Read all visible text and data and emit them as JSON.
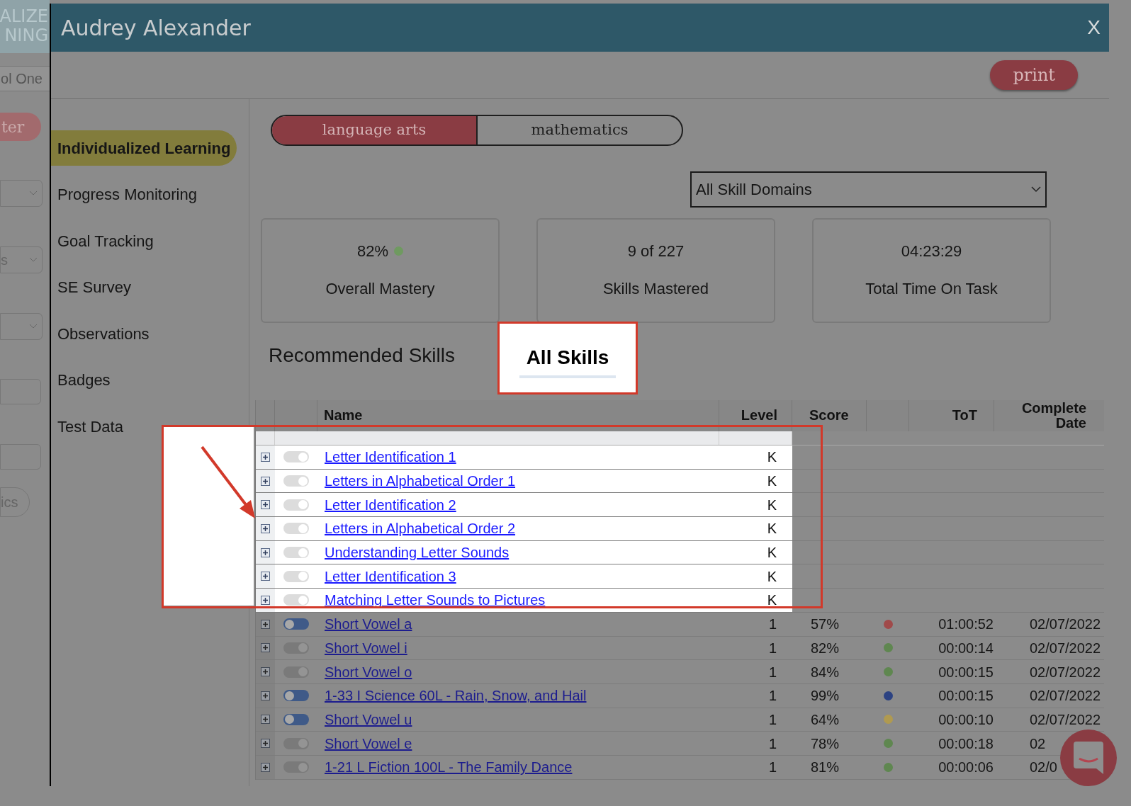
{
  "background": {
    "logo_lines": [
      "ALIZE",
      "NING"
    ],
    "school_field": "ol One",
    "filter_button": "ter",
    "select_value": "s",
    "bottom_button": "ics"
  },
  "window": {
    "title": "Audrey Alexander",
    "close": "X"
  },
  "toolbar": {
    "print_button": "print"
  },
  "sidebar": {
    "items": [
      {
        "label": "Individualized Learning",
        "selected": true
      },
      {
        "label": "Progress Monitoring",
        "selected": false
      },
      {
        "label": "Goal Tracking",
        "selected": false
      },
      {
        "label": "SE Survey",
        "selected": false
      },
      {
        "label": "Observations",
        "selected": false
      },
      {
        "label": "Badges",
        "selected": false
      },
      {
        "label": "Test Data",
        "selected": false
      }
    ]
  },
  "subjects": [
    {
      "label": "language arts",
      "selected": true
    },
    {
      "label": "mathematics",
      "selected": false
    }
  ],
  "domain_select": {
    "value": "All Skill Domains"
  },
  "stats": [
    {
      "value": "82%",
      "label": "Overall Mastery",
      "color": "#6f9a60"
    },
    {
      "value": "9 of 227",
      "label": "Skills Mastered"
    },
    {
      "value": "04:23:29",
      "label": "Total Time On Task"
    }
  ],
  "skill_tabs": [
    {
      "label": "Recommended Skills",
      "selected": false,
      "highlighted": false
    },
    {
      "label": "All Skills",
      "selected": true,
      "highlighted": true
    }
  ],
  "table": {
    "columns": [
      "Name",
      "Level",
      "Score",
      "ToT",
      "Complete Date"
    ],
    "rows": [
      {
        "name": "Letter Identification 1",
        "level": "K",
        "on": true,
        "highlighted": true
      },
      {
        "name": "Letters in Alphabetical Order 1",
        "level": "K",
        "on": true,
        "highlighted": true
      },
      {
        "name": "Letter Identification 2",
        "level": "K",
        "on": true,
        "highlighted": true
      },
      {
        "name": "Letters in Alphabetical Order 2",
        "level": "K",
        "on": true,
        "highlighted": true
      },
      {
        "name": "Understanding Letter Sounds",
        "level": "K",
        "on": true,
        "highlighted": true
      },
      {
        "name": "Letter Identification 3",
        "level": "K",
        "on": true,
        "highlighted": true
      },
      {
        "name": "Matching Letter Sounds to Pictures",
        "level": "K",
        "on": true,
        "highlighted": true
      },
      {
        "name": "Short Vowel a",
        "level": "1",
        "score": "57%",
        "color": "#a04a4a",
        "tot": "01:00:52",
        "date": "02/07/2022",
        "on": false,
        "highlighted": false
      },
      {
        "name": "Short Vowel i",
        "level": "1",
        "score": "82%",
        "color": "#5f8750",
        "tot": "00:00:14",
        "date": "02/07/2022",
        "on": true,
        "highlighted": false
      },
      {
        "name": "Short Vowel o",
        "level": "1",
        "score": "84%",
        "color": "#5f8750",
        "tot": "00:00:15",
        "date": "02/07/2022",
        "on": true,
        "highlighted": false
      },
      {
        "name": "1-33 I Science 60L - Rain, Snow, and Hail",
        "level": "1",
        "score": "99%",
        "color": "#2c4282",
        "tot": "00:00:15",
        "date": "02/07/2022",
        "on": false,
        "highlighted": false
      },
      {
        "name": "Short Vowel u",
        "level": "1",
        "score": "64%",
        "color": "#b09a50",
        "tot": "00:00:10",
        "date": "02/07/2022",
        "on": false,
        "highlighted": false
      },
      {
        "name": "Short Vowel e",
        "level": "1",
        "score": "78%",
        "color": "#5f8750",
        "tot": "00:00:18",
        "date": "02",
        "on": true,
        "highlighted": false
      },
      {
        "name": "1-21 L Fiction 100L - The Family Dance",
        "level": "1",
        "score": "81%",
        "color": "#5f8750",
        "tot": "00:00:06",
        "date": "02/0",
        "on": true,
        "highlighted": false
      }
    ]
  }
}
